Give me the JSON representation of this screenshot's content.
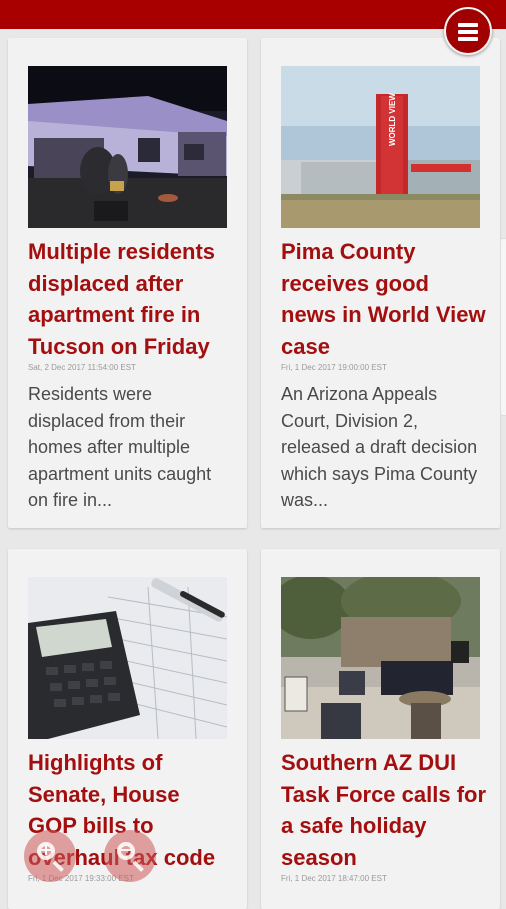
{
  "app": {
    "brand_color": "#a80000",
    "title_color": "#a30f0f"
  },
  "menu": {
    "icon": "hamburger-menu-icon"
  },
  "articles": [
    {
      "title": "Multiple residents displaced after apartment fire in Tucson on Friday",
      "date": "Sat, 2 Dec 2017 11:54:00 EST",
      "summary": "Residents were displaced from their homes after multiple apartment units caught on fire in...",
      "image": "apartment-fire-photo"
    },
    {
      "title": "Pima County receives good news in World View case",
      "date": "Fri, 1 Dec 2017 19:00:00 EST",
      "summary": "An Arizona Appeals Court, Division 2, released a draft decision which says Pima County was...",
      "image": "world-view-building-photo",
      "image_sign": "WORLD VIEW"
    },
    {
      "title": "Highlights of Senate, House GOP bills to overhaul tax code",
      "date": "Fri, 1 Dec 2017 19:33:00 EST",
      "summary": "",
      "image": "calculator-tax-form-photo"
    },
    {
      "title": "Southern AZ DUI Task Force calls for a safe holiday season",
      "date": "Fri, 1 Dec 2017 18:47:00 EST",
      "summary": "",
      "image": "press-conference-photo"
    }
  ],
  "zoom_controls": {
    "zoom_in_icon": "zoom-in-icon",
    "zoom_out_icon": "zoom-out-icon"
  }
}
